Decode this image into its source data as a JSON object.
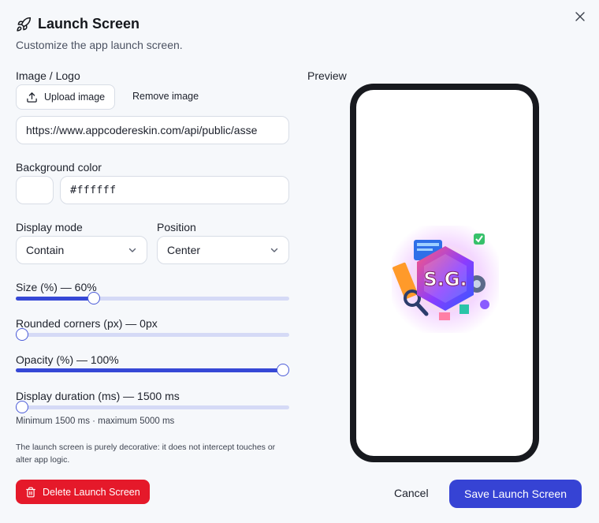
{
  "dialog": {
    "title": "Launch Screen",
    "subtitle": "Customize the app launch screen."
  },
  "image": {
    "label": "Image / Logo",
    "upload_label": "Upload image",
    "remove_label": "Remove image",
    "url_value": "https://www.appcodereskin.com/api/public/asse"
  },
  "background": {
    "label": "Background color",
    "color_value": "#ffffff"
  },
  "display_mode": {
    "label": "Display mode",
    "selected": "Contain"
  },
  "position": {
    "label": "Position",
    "selected": "Center"
  },
  "sliders": {
    "size": {
      "label": "Size (%) — 60%",
      "value_fraction": 0.276
    },
    "corners": {
      "label": "Rounded corners (px) — 0px",
      "value_fraction": 0.0
    },
    "opacity": {
      "label": "Opacity (%) — 100%",
      "value_fraction": 1.0
    },
    "duration": {
      "label": "Display duration (ms) — 1500 ms",
      "value_fraction": 0.0,
      "hint": "Minimum 1500 ms · maximum 5000 ms"
    }
  },
  "note": "The launch screen is purely decorative: it does not intercept touches or alter app logic.",
  "delete_label": "Delete Launch Screen",
  "preview": {
    "label": "Preview",
    "logo_text": "S.G."
  },
  "footer": {
    "cancel_label": "Cancel",
    "save_label": "Save Launch Screen"
  },
  "colors": {
    "accent": "#3643d4",
    "danger": "#e5192a",
    "slider_track": "#d5daf6",
    "phone_frame": "#17191e"
  },
  "icons": [
    "close-icon",
    "rocket-icon",
    "upload-icon",
    "trash-icon"
  ]
}
